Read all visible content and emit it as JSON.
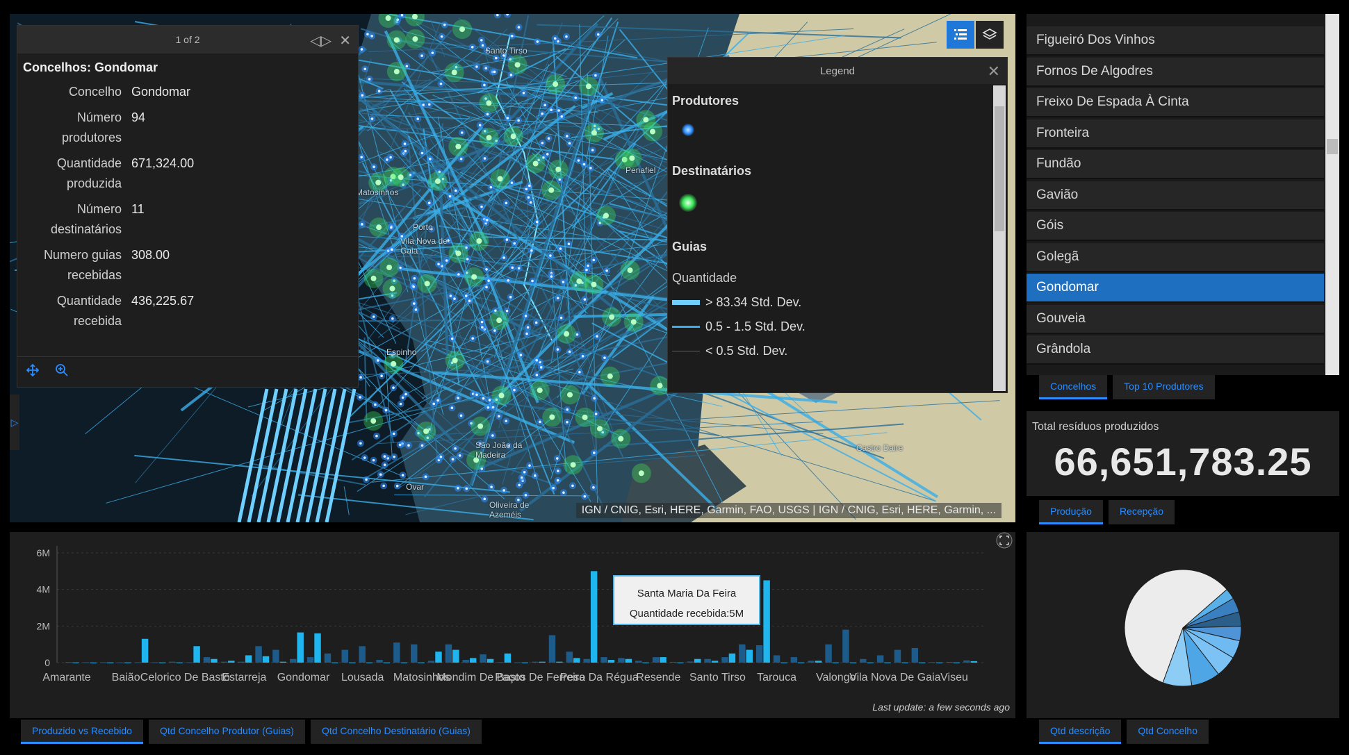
{
  "map": {
    "attribution": "IGN / CNIG, Esri, HERE, Garmin, FAO, USGS | IGN / CNIG, Esri, HERE, Garmin, ...",
    "place_labels": [
      "Santo Tirso",
      "Matosinhos",
      "Porto",
      "Vila Nova de Gaia",
      "Espinho",
      "São João da Madeira",
      "Ovar",
      "Oliveira de Azeméis",
      "Castro Daire",
      "Penafiel"
    ]
  },
  "popup": {
    "pager": "1 of 2",
    "title": "Concelhos: Gondomar",
    "attributes": [
      {
        "label1": "Concelho",
        "label2": "",
        "value": "Gondomar"
      },
      {
        "label1": "Número",
        "label2": "produtores",
        "value": "94"
      },
      {
        "label1": "Quantidade",
        "label2": "produzida",
        "value": "671,324.00"
      },
      {
        "label1": "Número",
        "label2": "destinatários",
        "value": "11"
      },
      {
        "label1": "Numero guias",
        "label2": "recebidas",
        "value": "308.00"
      },
      {
        "label1": "Quantidade",
        "label2": "recebida",
        "value": "436,225.67"
      }
    ]
  },
  "legend": {
    "title": "Legend",
    "layer1": "Produtores",
    "layer2": "Destinatários",
    "layer3": "Guias",
    "field": "Quantidade",
    "classes": [
      "> 83.34 Std. Dev.",
      "0.5 - 1.5 Std. Dev.",
      "< 0.5 Std. Dev."
    ],
    "colors": {
      "produtores": "#2a8cff",
      "destinatarios": "#3be85a",
      "guias": "#4fc3f7"
    }
  },
  "list": {
    "items": [
      "Figueiró Dos Vinhos",
      "Fornos De Algodres",
      "Freixo De Espada À Cinta",
      "Fronteira",
      "Fundão",
      "Gavião",
      "Góis",
      "Golegã",
      "Gondomar",
      "Gouveia",
      "Grândola"
    ],
    "selected": "Gondomar",
    "tabs": [
      "Concelhos",
      "Top 10 Produtores"
    ]
  },
  "indicator": {
    "title": "Total resíduos produzidos",
    "value": "66,651,783.25",
    "tabs": [
      "Produção",
      "Recepção"
    ]
  },
  "bar": {
    "tooltip_title": "Santa Maria Da Feira",
    "tooltip_value": "Quantidade recebida:5M",
    "last_update": "Last update: a few seconds ago",
    "tabs": [
      "Produzido vs Recebido",
      "Qtd Concelho Produtor (Guias)",
      "Qtd Concelho Destinatário (Guias)"
    ]
  },
  "pie_tabs": [
    "Qtd descrição",
    "Qtd Concelho"
  ],
  "chart_data": [
    {
      "type": "bar",
      "ylim": [
        0,
        6000000
      ],
      "yticks": [
        "0",
        "2M",
        "4M",
        "6M"
      ],
      "x_tick_labels": [
        "Amarante",
        "Baião",
        "Celorico De Basto",
        "Estarreja",
        "Gondomar",
        "Lousada",
        "Matosinhos",
        "Mondim De Basto",
        "Paços De Ferreira",
        "Peso Da Régua",
        "Resende",
        "Santo Tirso",
        "Tarouca",
        "Valongo",
        "Vila Nova De Gaia",
        "Viseu"
      ],
      "series": [
        {
          "name": "Quantidade produzida",
          "values": [
            30000,
            20000,
            20000,
            10000,
            20000,
            20000,
            50000,
            20000,
            300000,
            50000,
            50000,
            900000,
            700000,
            200000,
            300000,
            500000,
            700000,
            900000,
            150000,
            1100000,
            1000000,
            100000,
            1000000,
            150000,
            450000,
            30000,
            20000,
            50000,
            1500000,
            600000,
            200000,
            300000,
            250000,
            100000,
            300000,
            40000,
            60000,
            200000,
            300000,
            1000000,
            950000,
            400000,
            300000,
            100000,
            1000000,
            1800000,
            200000,
            400000,
            700000,
            800000,
            30000,
            40000,
            120000
          ]
        },
        {
          "name": "Quantidade recebida",
          "values": [
            10000,
            5000,
            10000,
            10000,
            1300000,
            10000,
            10000,
            900000,
            200000,
            100000,
            400000,
            350000,
            50000,
            1650000,
            1600000,
            10000,
            10000,
            10000,
            10000,
            10000,
            10000,
            600000,
            700000,
            250000,
            200000,
            500000,
            10000,
            50000,
            50000,
            250000,
            5000000,
            150000,
            200000,
            10000,
            300000,
            10000,
            200000,
            100000,
            500000,
            700000,
            4500000,
            10000,
            10000,
            100000,
            10000,
            10000,
            10000,
            10000,
            10000,
            10000,
            10000,
            10000,
            80000
          ]
        }
      ]
    },
    {
      "type": "pie",
      "values": [
        58,
        3,
        4,
        4,
        4,
        5,
        6,
        8,
        8
      ],
      "colors": [
        "#ececec",
        "#5ab0e8",
        "#3a7fc0",
        "#2c5e8a",
        "#4f94d6",
        "#6fbaf0",
        "#7cc2f5",
        "#4ea6e6",
        "#8dcdf5"
      ]
    }
  ]
}
